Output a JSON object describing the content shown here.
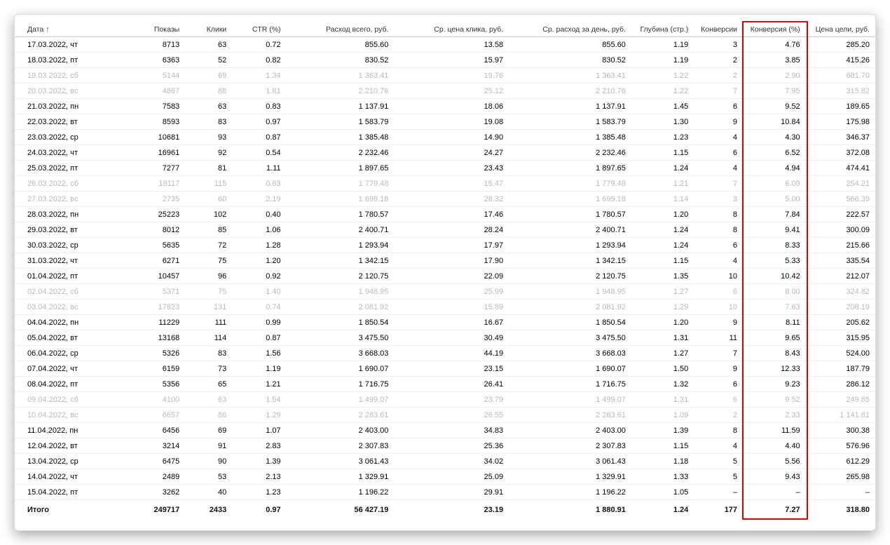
{
  "headers": {
    "date": "Дата ↑",
    "impressions": "Показы",
    "clicks": "Клики",
    "ctr": "CTR (%)",
    "spend": "Расход всего, руб.",
    "cpc": "Ср. цена клика, руб.",
    "spend_day": "Ср. расход за день, руб.",
    "depth": "Глубина (стр.)",
    "conversions": "Конверсии",
    "conv_pct": "Конверсия (%)",
    "goal_cost": "Цена цели, руб."
  },
  "rows": [
    {
      "date": "17.03.2022, чт",
      "impr": "8713",
      "clicks": "63",
      "ctr": "0.72",
      "spend": "855.60",
      "cpc": "13.58",
      "spend_day": "855.60",
      "depth": "1.19",
      "conv": "3",
      "conv_pct": "4.76",
      "goal": "285.20",
      "muted": false
    },
    {
      "date": "18.03.2022, пт",
      "impr": "6363",
      "clicks": "52",
      "ctr": "0.82",
      "spend": "830.52",
      "cpc": "15.97",
      "spend_day": "830.52",
      "depth": "1.19",
      "conv": "2",
      "conv_pct": "3.85",
      "goal": "415.26",
      "muted": false
    },
    {
      "date": "19.03.2022, сб",
      "impr": "5144",
      "clicks": "69",
      "ctr": "1.34",
      "spend": "1 363.41",
      "cpc": "19.76",
      "spend_day": "1 363.41",
      "depth": "1.22",
      "conv": "2",
      "conv_pct": "2.90",
      "goal": "681.70",
      "muted": true
    },
    {
      "date": "20.03.2022, вс",
      "impr": "4867",
      "clicks": "88",
      "ctr": "1.81",
      "spend": "2 210.76",
      "cpc": "25.12",
      "spend_day": "2 210.76",
      "depth": "1.22",
      "conv": "7",
      "conv_pct": "7.95",
      "goal": "315.82",
      "muted": true
    },
    {
      "date": "21.03.2022, пн",
      "impr": "7583",
      "clicks": "63",
      "ctr": "0.83",
      "spend": "1 137.91",
      "cpc": "18.06",
      "spend_day": "1 137.91",
      "depth": "1.45",
      "conv": "6",
      "conv_pct": "9.52",
      "goal": "189.65",
      "muted": false
    },
    {
      "date": "22.03.2022, вт",
      "impr": "8593",
      "clicks": "83",
      "ctr": "0.97",
      "spend": "1 583.79",
      "cpc": "19.08",
      "spend_day": "1 583.79",
      "depth": "1.30",
      "conv": "9",
      "conv_pct": "10.84",
      "goal": "175.98",
      "muted": false
    },
    {
      "date": "23.03.2022, ср",
      "impr": "10681",
      "clicks": "93",
      "ctr": "0.87",
      "spend": "1 385.48",
      "cpc": "14.90",
      "spend_day": "1 385.48",
      "depth": "1.23",
      "conv": "4",
      "conv_pct": "4.30",
      "goal": "346.37",
      "muted": false
    },
    {
      "date": "24.03.2022, чт",
      "impr": "16961",
      "clicks": "92",
      "ctr": "0.54",
      "spend": "2 232.46",
      "cpc": "24.27",
      "spend_day": "2 232.46",
      "depth": "1.15",
      "conv": "6",
      "conv_pct": "6.52",
      "goal": "372.08",
      "muted": false
    },
    {
      "date": "25.03.2022, пт",
      "impr": "7277",
      "clicks": "81",
      "ctr": "1.11",
      "spend": "1 897.65",
      "cpc": "23.43",
      "spend_day": "1 897.65",
      "depth": "1.24",
      "conv": "4",
      "conv_pct": "4.94",
      "goal": "474.41",
      "muted": false
    },
    {
      "date": "26.03.2022, сб",
      "impr": "18117",
      "clicks": "115",
      "ctr": "0.63",
      "spend": "1 779.48",
      "cpc": "15.47",
      "spend_day": "1 779.48",
      "depth": "1.21",
      "conv": "7",
      "conv_pct": "6.09",
      "goal": "254.21",
      "muted": true
    },
    {
      "date": "27.03.2022, вс",
      "impr": "2735",
      "clicks": "60",
      "ctr": "2.19",
      "spend": "1 699.18",
      "cpc": "28.32",
      "spend_day": "1 699.18",
      "depth": "1.14",
      "conv": "3",
      "conv_pct": "5.00",
      "goal": "566.39",
      "muted": true
    },
    {
      "date": "28.03.2022, пн",
      "impr": "25223",
      "clicks": "102",
      "ctr": "0.40",
      "spend": "1 780.57",
      "cpc": "17.46",
      "spend_day": "1 780.57",
      "depth": "1.20",
      "conv": "8",
      "conv_pct": "7.84",
      "goal": "222.57",
      "muted": false
    },
    {
      "date": "29.03.2022, вт",
      "impr": "8012",
      "clicks": "85",
      "ctr": "1.06",
      "spend": "2 400.71",
      "cpc": "28.24",
      "spend_day": "2 400.71",
      "depth": "1.24",
      "conv": "8",
      "conv_pct": "9.41",
      "goal": "300.09",
      "muted": false
    },
    {
      "date": "30.03.2022, ср",
      "impr": "5635",
      "clicks": "72",
      "ctr": "1.28",
      "spend": "1 293.94",
      "cpc": "17.97",
      "spend_day": "1 293.94",
      "depth": "1.24",
      "conv": "6",
      "conv_pct": "8.33",
      "goal": "215.66",
      "muted": false
    },
    {
      "date": "31.03.2022, чт",
      "impr": "6271",
      "clicks": "75",
      "ctr": "1.20",
      "spend": "1 342.15",
      "cpc": "17.90",
      "spend_day": "1 342.15",
      "depth": "1.15",
      "conv": "4",
      "conv_pct": "5.33",
      "goal": "335.54",
      "muted": false
    },
    {
      "date": "01.04.2022, пт",
      "impr": "10457",
      "clicks": "96",
      "ctr": "0.92",
      "spend": "2 120.75",
      "cpc": "22.09",
      "spend_day": "2 120.75",
      "depth": "1.35",
      "conv": "10",
      "conv_pct": "10.42",
      "goal": "212.07",
      "muted": false
    },
    {
      "date": "02.04.2022, сб",
      "impr": "5371",
      "clicks": "75",
      "ctr": "1.40",
      "spend": "1 948.95",
      "cpc": "25.99",
      "spend_day": "1 948.95",
      "depth": "1.27",
      "conv": "6",
      "conv_pct": "8.00",
      "goal": "324.82",
      "muted": true
    },
    {
      "date": "03.04.2022, вс",
      "impr": "17823",
      "clicks": "131",
      "ctr": "0.74",
      "spend": "2 081.92",
      "cpc": "15.89",
      "spend_day": "2 081.92",
      "depth": "1.29",
      "conv": "10",
      "conv_pct": "7.63",
      "goal": "208.19",
      "muted": true
    },
    {
      "date": "04.04.2022, пн",
      "impr": "11229",
      "clicks": "111",
      "ctr": "0.99",
      "spend": "1 850.54",
      "cpc": "16.67",
      "spend_day": "1 850.54",
      "depth": "1.20",
      "conv": "9",
      "conv_pct": "8.11",
      "goal": "205.62",
      "muted": false
    },
    {
      "date": "05.04.2022, вт",
      "impr": "13168",
      "clicks": "114",
      "ctr": "0.87",
      "spend": "3 475.50",
      "cpc": "30.49",
      "spend_day": "3 475.50",
      "depth": "1.31",
      "conv": "11",
      "conv_pct": "9.65",
      "goal": "315.95",
      "muted": false
    },
    {
      "date": "06.04.2022, ср",
      "impr": "5326",
      "clicks": "83",
      "ctr": "1.56",
      "spend": "3 668.03",
      "cpc": "44.19",
      "spend_day": "3 668.03",
      "depth": "1.27",
      "conv": "7",
      "conv_pct": "8.43",
      "goal": "524.00",
      "muted": false
    },
    {
      "date": "07.04.2022, чт",
      "impr": "6159",
      "clicks": "73",
      "ctr": "1.19",
      "spend": "1 690.07",
      "cpc": "23.15",
      "spend_day": "1 690.07",
      "depth": "1.50",
      "conv": "9",
      "conv_pct": "12.33",
      "goal": "187.79",
      "muted": false
    },
    {
      "date": "08.04.2022, пт",
      "impr": "5356",
      "clicks": "65",
      "ctr": "1.21",
      "spend": "1 716.75",
      "cpc": "26.41",
      "spend_day": "1 716.75",
      "depth": "1.32",
      "conv": "6",
      "conv_pct": "9.23",
      "goal": "286.12",
      "muted": false
    },
    {
      "date": "09.04.2022, сб",
      "impr": "4100",
      "clicks": "63",
      "ctr": "1.54",
      "spend": "1 499.07",
      "cpc": "23.79",
      "spend_day": "1 499.07",
      "depth": "1.31",
      "conv": "6",
      "conv_pct": "9.52",
      "goal": "249.85",
      "muted": true
    },
    {
      "date": "10.04.2022, вс",
      "impr": "6657",
      "clicks": "86",
      "ctr": "1.29",
      "spend": "2 283.61",
      "cpc": "26.55",
      "spend_day": "2 283.61",
      "depth": "1.09",
      "conv": "2",
      "conv_pct": "2.33",
      "goal": "1 141.81",
      "muted": true
    },
    {
      "date": "11.04.2022, пн",
      "impr": "6456",
      "clicks": "69",
      "ctr": "1.07",
      "spend": "2 403.00",
      "cpc": "34.83",
      "spend_day": "2 403.00",
      "depth": "1.39",
      "conv": "8",
      "conv_pct": "11.59",
      "goal": "300.38",
      "muted": false
    },
    {
      "date": "12.04.2022, вт",
      "impr": "3214",
      "clicks": "91",
      "ctr": "2.83",
      "spend": "2 307.83",
      "cpc": "25.36",
      "spend_day": "2 307.83",
      "depth": "1.15",
      "conv": "4",
      "conv_pct": "4.40",
      "goal": "576.96",
      "muted": false
    },
    {
      "date": "13.04.2022, ср",
      "impr": "6475",
      "clicks": "90",
      "ctr": "1.39",
      "spend": "3 061.43",
      "cpc": "34.02",
      "spend_day": "3 061.43",
      "depth": "1.18",
      "conv": "5",
      "conv_pct": "5.56",
      "goal": "612.29",
      "muted": false
    },
    {
      "date": "14.04.2022, чт",
      "impr": "2489",
      "clicks": "53",
      "ctr": "2.13",
      "spend": "1 329.91",
      "cpc": "25.09",
      "spend_day": "1 329.91",
      "depth": "1.33",
      "conv": "5",
      "conv_pct": "9.43",
      "goal": "265.98",
      "muted": false
    },
    {
      "date": "15.04.2022, пт",
      "impr": "3262",
      "clicks": "40",
      "ctr": "1.23",
      "spend": "1 196.22",
      "cpc": "29.91",
      "spend_day": "1 196.22",
      "depth": "1.05",
      "conv": "–",
      "conv_pct": "–",
      "goal": "–",
      "muted": false
    }
  ],
  "total": {
    "label": "Итого",
    "impr": "249717",
    "clicks": "2433",
    "ctr": "0.97",
    "spend": "56 427.19",
    "cpc": "23.19",
    "spend_day": "1 880.91",
    "depth": "1.24",
    "conv": "177",
    "conv_pct": "7.27",
    "goal": "318.80"
  }
}
